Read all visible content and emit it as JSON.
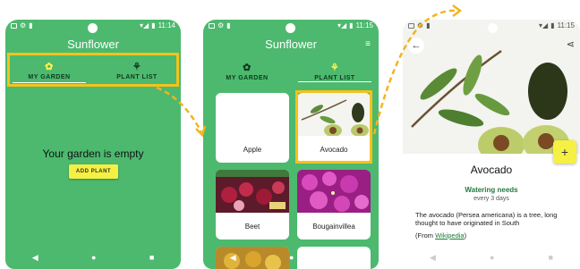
{
  "screen1": {
    "status_time": "11:14",
    "title": "Sunflower",
    "tabs": [
      "MY GARDEN",
      "PLANT LIST"
    ],
    "empty_text": "Your garden is empty",
    "add_button": "ADD PLANT"
  },
  "screen2": {
    "status_time": "11:15",
    "title": "Sunflower",
    "tabs": [
      "MY GARDEN",
      "PLANT LIST"
    ],
    "plants": [
      "Apple",
      "Avocado",
      "Beet",
      "Bougainvillea"
    ]
  },
  "screen3": {
    "status_time": "11:15",
    "plant_name": "Avocado",
    "watering_title": "Watering needs",
    "watering_value": "every 3 days",
    "description": "The avocado (Persea americana) is a tree, long thought to have originated in South",
    "source_prefix": "(From ",
    "source_link": "Wikipedia",
    "source_suffix": ")"
  },
  "icons": [
    "back-arrow-icon",
    "share-icon",
    "add-icon",
    "filter-icon",
    "flower-icon",
    "plant-icon"
  ],
  "colors": {
    "green": "#4CB96E",
    "highlight": "#F4C21B",
    "yellow": "#F5F043"
  }
}
